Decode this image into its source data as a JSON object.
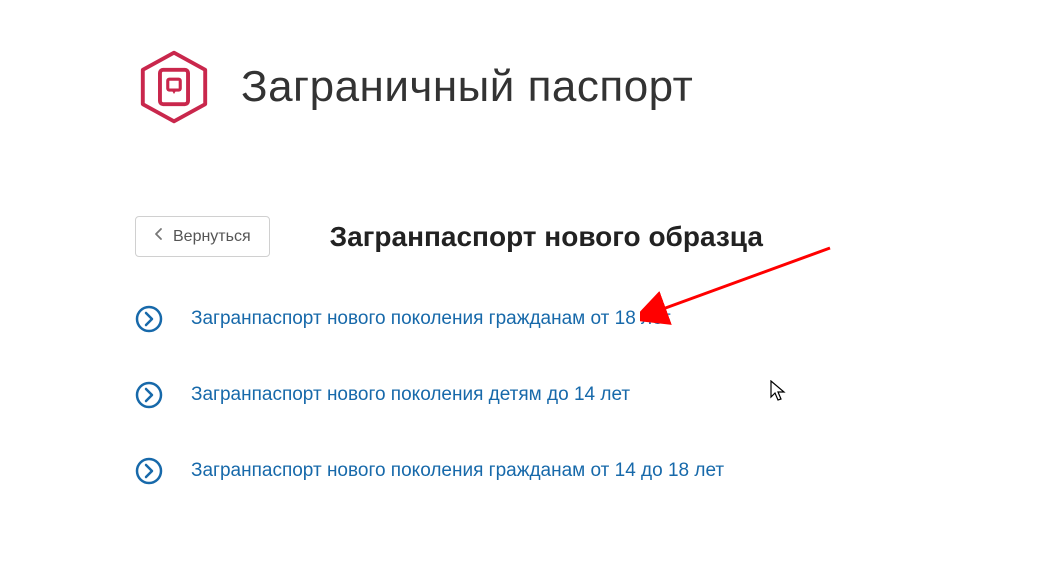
{
  "header": {
    "title": "Заграничный паспорт"
  },
  "back": {
    "label": "Вернуться"
  },
  "subheader": {
    "title": "Загранпаспорт нового образца"
  },
  "options": [
    {
      "label": "Загранпаспорт нового поколения гражданам от 18 лет"
    },
    {
      "label": "Загранпаспорт нового поколения детям до 14 лет"
    },
    {
      "label": "Загранпаспорт нового поколения гражданам от 14 до 18 лет"
    }
  ]
}
